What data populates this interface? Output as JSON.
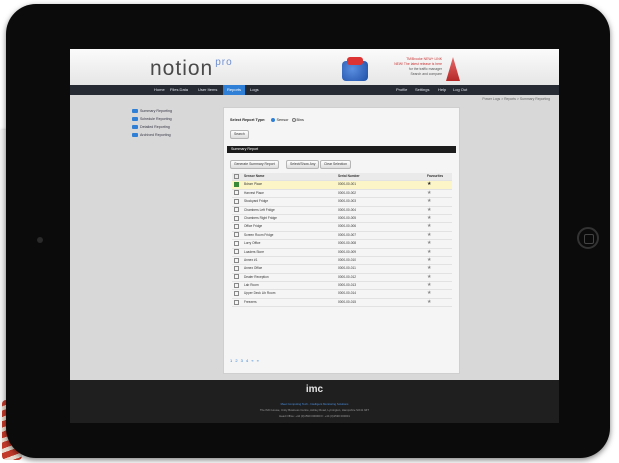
{
  "app": {
    "logo": "notion",
    "logo_suffix": "pro"
  },
  "promo": {
    "line1": "TM/Brooke NEW+ LINK",
    "line2": "NEW! The latest release is here",
    "line3": "for the traffic manager",
    "line4": "Search and compare"
  },
  "nav": {
    "left": [
      "Home",
      "Files Data",
      "User Items",
      "Reports",
      "Logs"
    ],
    "right": [
      "Profile",
      "Settings",
      "Help",
      "Log Out"
    ],
    "active": "Reports"
  },
  "breadcrumb": "Power Logs  >  Reports  >  Summary Reporting",
  "sidebar": {
    "items": [
      "Summary Reporting",
      "Schedule Reporting",
      "Detailed Reporting",
      "Archived Reporting"
    ]
  },
  "report": {
    "type_label": "Select Report Type:",
    "options": [
      "Sensor",
      "Bins"
    ],
    "selected": "Sensor",
    "search_button": "Search",
    "section_title": "Summary Report",
    "buttons": [
      "Generate Summary Report",
      "Select/Show Any",
      "Clear Selection"
    ]
  },
  "table": {
    "headers": {
      "name": "Sensor Name",
      "serial": "Serial Number",
      "fav": "Favourites"
    },
    "rows": [
      {
        "name": "Bdrcm Place",
        "serial": "0000-00-001"
      },
      {
        "name": "Harvest Place",
        "serial": "0000-00-002"
      },
      {
        "name": "Stockyard Fridge",
        "serial": "0000-00-003"
      },
      {
        "name": "Chambers Left Fridge",
        "serial": "0000-00-004"
      },
      {
        "name": "Chambers Right Fridge",
        "serial": "0000-00-005"
      },
      {
        "name": "Office Fridge",
        "serial": "0000-00-006"
      },
      {
        "name": "Screen Room Fridge",
        "serial": "0000-00-007"
      },
      {
        "name": "Lorry Office",
        "serial": "0000-00-008"
      },
      {
        "name": "Loaders Store",
        "serial": "0000-00-009"
      },
      {
        "name": "Annex #1",
        "serial": "0000-00-010"
      },
      {
        "name": "Annex Office",
        "serial": "0000-00-011"
      },
      {
        "name": "Dealer Reception",
        "serial": "0000-00-012"
      },
      {
        "name": "Lab Room",
        "serial": "0000-00-013"
      },
      {
        "name": "Upper Deck Lib Room",
        "serial": "0000-00-014"
      },
      {
        "name": "Freezers",
        "serial": "0000-00-015"
      }
    ],
    "selected_index": 0
  },
  "pager": "1 2 3 4 « »",
  "footer": {
    "logo": "imc",
    "line1": "Meet Computing Tech - Intelligent Monitoring Solutions",
    "line2": "The IMC House, Unity Business Centre, Ashley Road, Lymington, Hampshire SO41 9ZT",
    "line3": "Head Office: +44 (0)1590 000000  F: +44 (0)1590 000001"
  },
  "colors": {
    "accent": "#2f7fd6",
    "selected_row": "#fbf5c8",
    "nav_bg": "#262a33",
    "footer_bg": "#1f1f1f"
  }
}
